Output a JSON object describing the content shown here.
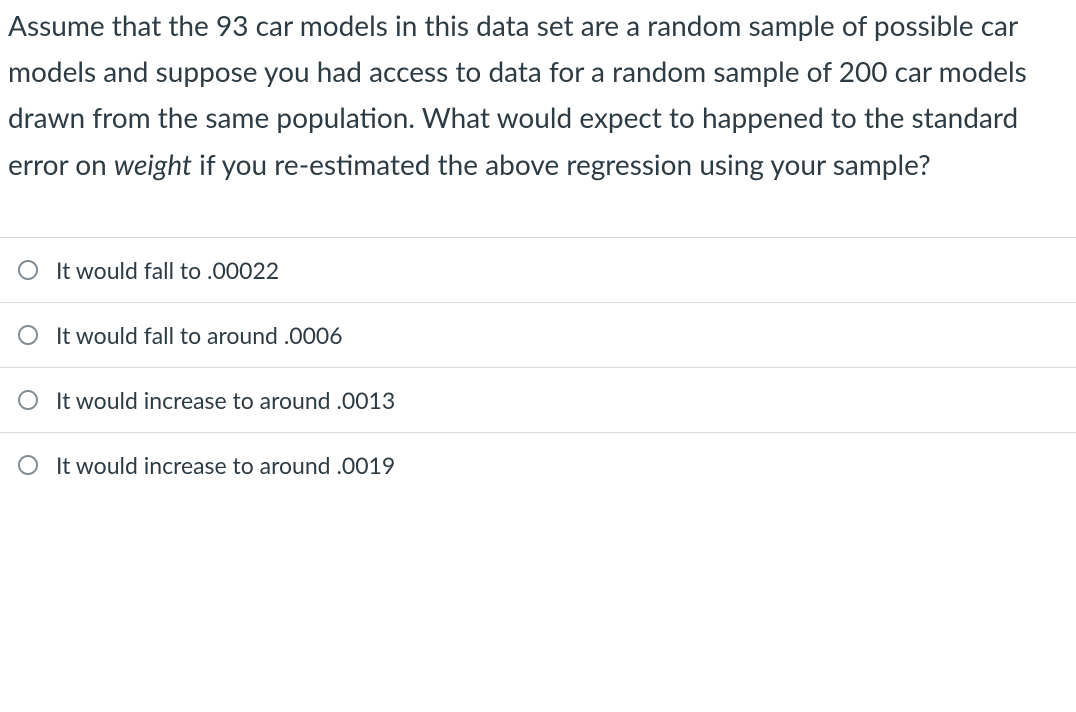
{
  "question": {
    "part1": "Assume that the 93 car models in this data set are a random sample of possible car models and suppose you had access to data for a random sample of 200 car models drawn from the same population.  What would expect to happened to the standard error on ",
    "italic_word": "weight",
    "part2": " if you re-estimated the above regression using your sample?"
  },
  "options": [
    {
      "label": "It would fall to .00022"
    },
    {
      "label": "It would fall to around .0006"
    },
    {
      "label": "It would increase to around .0013"
    },
    {
      "label": "It would increase to around .0019"
    }
  ]
}
